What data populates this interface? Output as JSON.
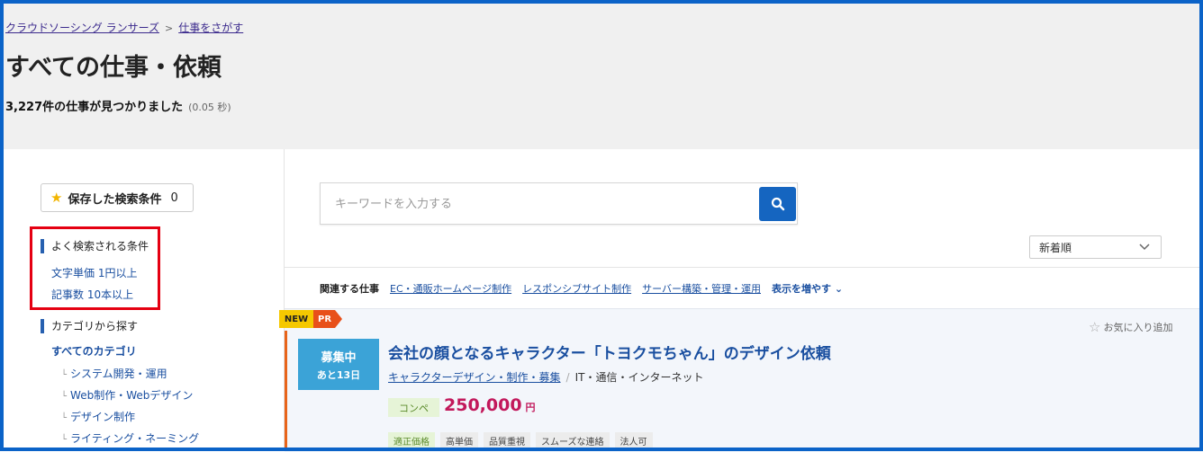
{
  "breadcrumb": {
    "home": "クラウドソーシング ランサーズ",
    "current": "仕事をさがす"
  },
  "page_title": "すべての仕事・依頼",
  "result": {
    "count_text": "3,227件の仕事が見つかりました",
    "time": "(0.05 秒)"
  },
  "saved_search": {
    "label": "保存した検索条件",
    "count": "0"
  },
  "popular_conditions": {
    "heading": "よく検索される条件",
    "items": [
      "文字単価 1円以上",
      "記事数 10本以上"
    ]
  },
  "category": {
    "heading": "カテゴリから探す",
    "all": "すべてのカテゴリ",
    "items": [
      "システム開発・運用",
      "Web制作・Webデザイン",
      "デザイン制作",
      "ライティング・ネーミング"
    ]
  },
  "search": {
    "placeholder": "キーワードを入力する"
  },
  "sort": {
    "selected": "新着順"
  },
  "related": {
    "label": "関連する仕事",
    "links": [
      "EC・通販ホームページ制作",
      "レスポンシブサイト制作",
      "サーバー構築・管理・運用"
    ],
    "more": "表示を増やす"
  },
  "job": {
    "tag_new": "NEW",
    "tag_pr": "PR",
    "status": "募集中",
    "remaining": "あと13日",
    "favorite": "お気に入り追加",
    "title": "会社の顔となるキャラクター「トヨクモちゃん」のデザイン依頼",
    "category_link": "キャラクターデザイン・制作・募集",
    "subcategory": "IT・通信・インターネット",
    "type": "コンペ",
    "price": "250,000",
    "price_unit": "円",
    "tags": [
      "適正価格",
      "高単価",
      "品質重視",
      "スムーズな連絡",
      "法人可"
    ]
  },
  "colors": {
    "accent": "#1565c0",
    "highlight_box": "#e50012",
    "price": "#c2185b",
    "status": "#3ba3d7"
  }
}
